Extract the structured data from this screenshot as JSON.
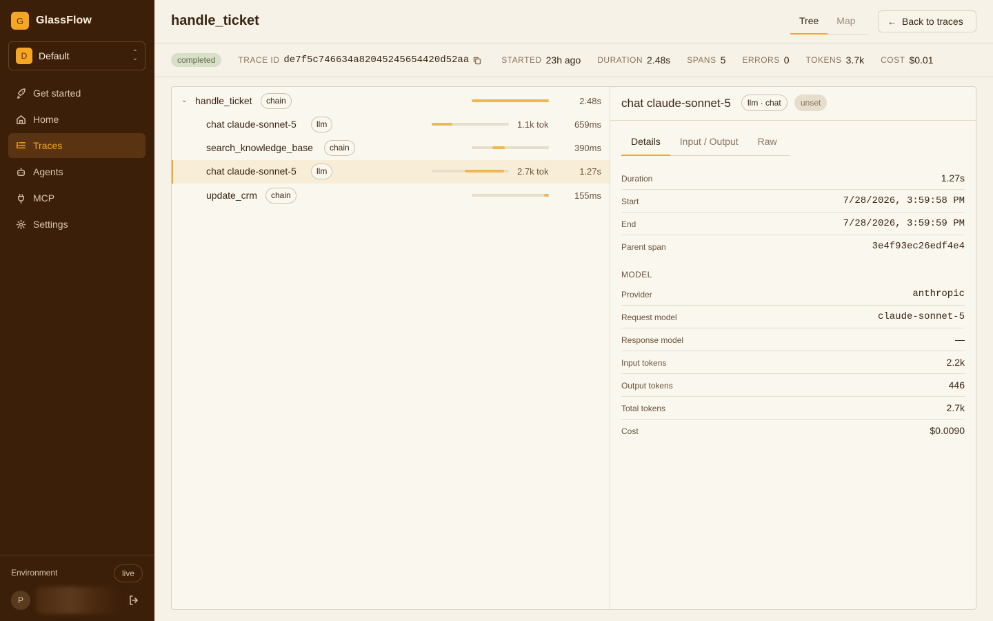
{
  "app": {
    "name": "GlassFlow",
    "logo_letter": "G"
  },
  "workspace": {
    "name": "Default",
    "avatar_letter": "D"
  },
  "nav": [
    {
      "label": "Get started",
      "icon": "rocket-icon"
    },
    {
      "label": "Home",
      "icon": "home-icon"
    },
    {
      "label": "Traces",
      "icon": "list-tree-icon",
      "active": true
    },
    {
      "label": "Agents",
      "icon": "bot-icon"
    },
    {
      "label": "MCP",
      "icon": "plug-icon"
    },
    {
      "label": "Settings",
      "icon": "gear-icon"
    }
  ],
  "environment": {
    "label": "Environment",
    "value": "live"
  },
  "user": {
    "avatar_letter": "P"
  },
  "header": {
    "title": "handle_ticket",
    "view_tabs": [
      "Tree",
      "Map"
    ],
    "active_view": "Tree",
    "back_label": "Back to traces"
  },
  "meta": {
    "status": "completed",
    "trace_id_label": "TRACE ID",
    "trace_id": "de7f5c746634a82045245654420d52aa",
    "started_label": "STARTED",
    "started": "23h ago",
    "duration_label": "DURATION",
    "duration": "2.48s",
    "spans_label": "SPANS",
    "spans": "5",
    "errors_label": "ERRORS",
    "errors": "0",
    "tokens_label": "TOKENS",
    "tokens": "3.7k",
    "cost_label": "COST",
    "cost": "$0.01"
  },
  "spans": [
    {
      "name": "handle_ticket",
      "kind": "chain",
      "tokens": "",
      "duration": "2.48s",
      "time_start": 0.0,
      "time_share": 1.0,
      "token_share": 0
    },
    {
      "name": "chat claude-sonnet-5",
      "kind": "llm",
      "tokens": "1.1k tok",
      "duration": "659ms",
      "time_start": 0.0,
      "time_share": 0.27,
      "token_share": 0.27
    },
    {
      "name": "search_knowledge_base",
      "kind": "chain",
      "tokens": "",
      "duration": "390ms",
      "time_start": 0.27,
      "time_share": 0.16,
      "token_share": 0
    },
    {
      "name": "chat claude-sonnet-5",
      "kind": "llm",
      "tokens": "2.7k tok",
      "duration": "1.27s",
      "time_start": 0.43,
      "time_share": 0.51,
      "token_share": 0.51,
      "selected": true
    },
    {
      "name": "update_crm",
      "kind": "chain",
      "tokens": "",
      "duration": "155ms",
      "time_start": 0.94,
      "time_share": 0.06,
      "token_share": 0
    }
  ],
  "detail": {
    "title": "chat claude-sonnet-5",
    "kind_badge": "llm · chat",
    "status_badge": "unset",
    "tabs": [
      "Details",
      "Input / Output",
      "Raw"
    ],
    "active_tab": "Details",
    "timing": [
      {
        "key": "Duration",
        "value": "1.27s"
      },
      {
        "key": "Start",
        "value": "7/28/2026, 3:59:58 PM"
      },
      {
        "key": "End",
        "value": "7/28/2026, 3:59:59 PM"
      },
      {
        "key": "Parent span",
        "value": "3e4f93ec26edf4e4"
      }
    ],
    "model_section_label": "MODEL",
    "model": [
      {
        "key": "Provider",
        "value": "anthropic"
      },
      {
        "key": "Request model",
        "value": "claude-sonnet-5"
      },
      {
        "key": "Response model",
        "value": "—"
      },
      {
        "key": "Input tokens",
        "value": "2.2k"
      },
      {
        "key": "Output tokens",
        "value": "446"
      },
      {
        "key": "Total tokens",
        "value": "2.7k"
      },
      {
        "key": "Cost",
        "value": "$0.0090"
      }
    ]
  },
  "colors": {
    "sidebar_bg": "#3b1f08",
    "accent": "#f5a623",
    "page_bg": "#f6f2e8"
  }
}
